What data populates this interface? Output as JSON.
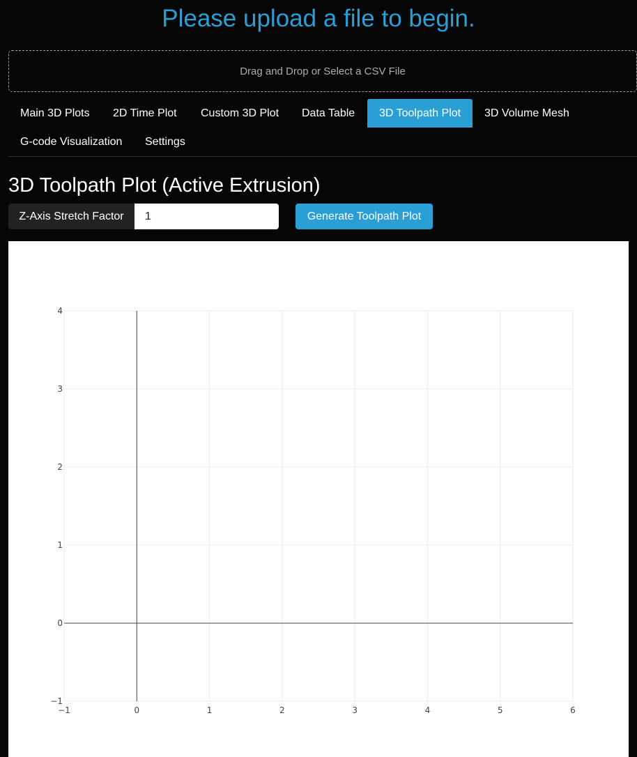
{
  "banner": {
    "text": "Please upload a file to begin."
  },
  "upload": {
    "label": "Drag and Drop or Select a CSV File"
  },
  "tabs": [
    {
      "label": "Main 3D Plots",
      "active": false
    },
    {
      "label": "2D Time Plot",
      "active": false
    },
    {
      "label": "Custom 3D Plot",
      "active": false
    },
    {
      "label": "Data Table",
      "active": false
    },
    {
      "label": "3D Toolpath Plot",
      "active": true
    },
    {
      "label": "3D Volume Mesh",
      "active": false
    },
    {
      "label": "G-code Visualization",
      "active": false
    },
    {
      "label": "Settings",
      "active": false
    }
  ],
  "section": {
    "title": "3D Toolpath Plot (Active Extrusion)"
  },
  "controls": {
    "stretch_label": "Z-Axis Stretch Factor",
    "stretch_value": "1",
    "generate_label": "Generate Toolpath Plot"
  },
  "colors": {
    "accent": "#2a9fd6",
    "background": "#060606"
  },
  "chart_data": {
    "type": "scatter",
    "series": [],
    "xlim": [
      -1,
      6
    ],
    "ylim": [
      -1,
      4
    ],
    "xticks": [
      "−1",
      "0",
      "1",
      "2",
      "3",
      "4",
      "5",
      "6"
    ],
    "yticks": [
      "−1",
      "0",
      "1",
      "2",
      "3",
      "4"
    ],
    "grid": true
  }
}
